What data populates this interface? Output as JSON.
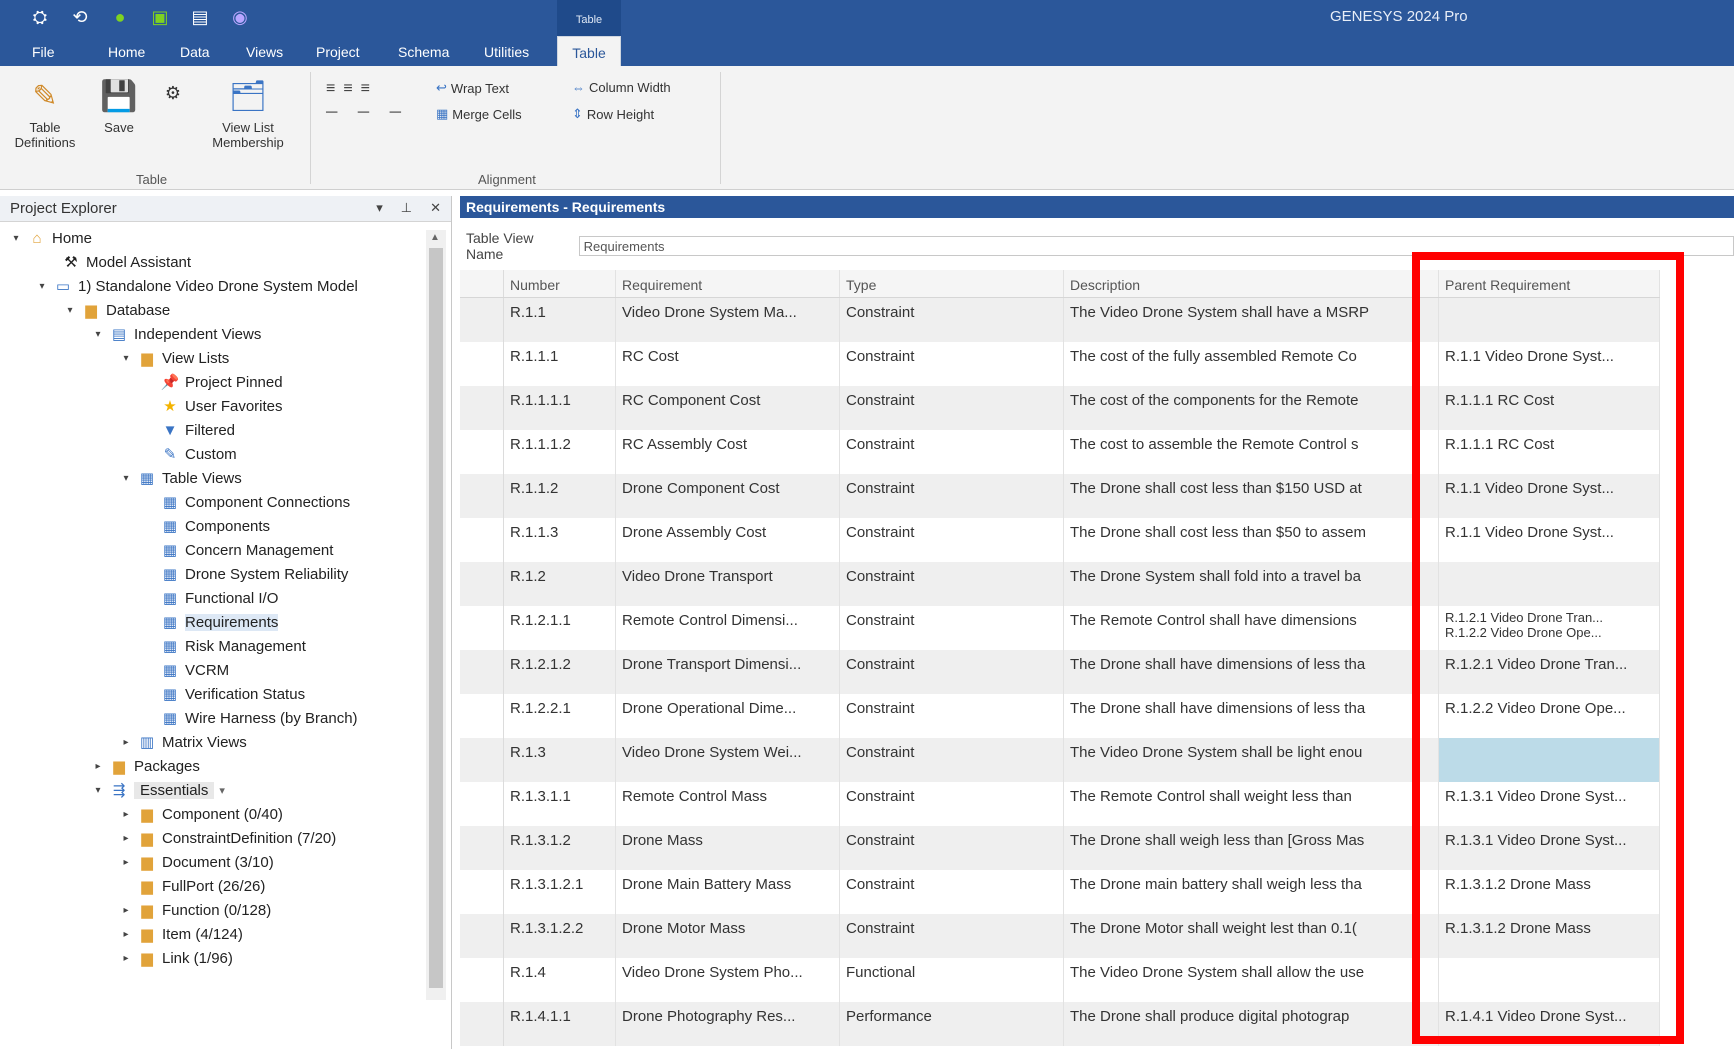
{
  "app": {
    "title": "GENESYS 2024 Pro",
    "context_tab_group": "Table"
  },
  "menu": [
    "File",
    "Home",
    "Data",
    "Views",
    "Project",
    "Schema",
    "Utilities",
    "Table"
  ],
  "ribbon": {
    "table_group": {
      "label": "Table",
      "buttons": [
        "Table Definitions",
        "Save",
        "View List Membership"
      ]
    },
    "alignment_group": {
      "label": "Alignment",
      "wrap_text": "Wrap Text",
      "merge_cells": "Merge Cells",
      "column_width": "Column Width",
      "row_height": "Row Height"
    }
  },
  "explorer": {
    "title": "Project Explorer",
    "nodes": [
      {
        "label": "Home",
        "icon": "home-icon"
      },
      {
        "label": "Model Assistant",
        "icon": "wizard-icon"
      },
      {
        "label": "1) Standalone Video Drone System Model",
        "icon": "project-icon"
      },
      {
        "label": "Database",
        "icon": "folder-icon"
      },
      {
        "label": "Independent Views",
        "icon": "views-icon"
      },
      {
        "label": "View Lists",
        "icon": "folder-icon"
      },
      {
        "label": "Project Pinned",
        "icon": "pin-icon"
      },
      {
        "label": "User Favorites",
        "icon": "star-icon"
      },
      {
        "label": "Filtered",
        "icon": "filter-icon"
      },
      {
        "label": "Custom",
        "icon": "custom-icon"
      },
      {
        "label": "Table Views",
        "icon": "table-icon"
      },
      {
        "label": "Component Connections",
        "icon": "table-icon"
      },
      {
        "label": "Components",
        "icon": "table-icon"
      },
      {
        "label": "Concern Management",
        "icon": "table-icon"
      },
      {
        "label": "Drone System Reliability",
        "icon": "table-icon"
      },
      {
        "label": "Functional I/O",
        "icon": "table-icon"
      },
      {
        "label": "Requirements",
        "icon": "table-icon"
      },
      {
        "label": "Risk Management",
        "icon": "table-icon"
      },
      {
        "label": "VCRM",
        "icon": "table-icon"
      },
      {
        "label": "Verification Status",
        "icon": "table-icon"
      },
      {
        "label": "Wire Harness (by Branch)",
        "icon": "table-icon"
      },
      {
        "label": "Matrix Views",
        "icon": "matrix-icon"
      },
      {
        "label": "Packages",
        "icon": "packages-icon"
      },
      {
        "label": "Essentials",
        "icon": "essentials-icon"
      },
      {
        "label": "Component (0/40)",
        "icon": "folder-icon"
      },
      {
        "label": "ConstraintDefinition (7/20)",
        "icon": "folder-icon"
      },
      {
        "label": "Document (3/10)",
        "icon": "folder-icon"
      },
      {
        "label": "FullPort (26/26)",
        "icon": "folder-icon"
      },
      {
        "label": "Function (0/128)",
        "icon": "folder-icon"
      },
      {
        "label": "Item (4/124)",
        "icon": "folder-icon"
      },
      {
        "label": "Link (1/96)",
        "icon": "folder-icon"
      }
    ]
  },
  "panel": {
    "title": "Requirements - Requirements",
    "view_name_label": "Table View Name",
    "view_name_value": "Requirements"
  },
  "table": {
    "columns": [
      "Number",
      "Requirement",
      "Type",
      "Description",
      "Parent Requirement"
    ],
    "rows": [
      [
        "R.1.1",
        "Video Drone System Ma...",
        "Constraint",
        "The Video Drone System shall have a MSRP",
        ""
      ],
      [
        "R.1.1.1",
        "RC Cost",
        "Constraint",
        "The cost of the fully assembled Remote Co",
        "R.1.1 Video Drone Syst..."
      ],
      [
        "R.1.1.1.1",
        "RC Component Cost",
        "Constraint",
        "The cost of the components for the Remote",
        "R.1.1.1 RC Cost"
      ],
      [
        "R.1.1.1.2",
        "RC Assembly Cost",
        "Constraint",
        "The cost to assemble the Remote Control s",
        "R.1.1.1 RC Cost"
      ],
      [
        "R.1.1.2",
        "Drone Component Cost",
        "Constraint",
        "The Drone shall cost less than $150 USD at",
        "R.1.1 Video Drone Syst..."
      ],
      [
        "R.1.1.3",
        "Drone Assembly Cost",
        "Constraint",
        "The Drone shall cost less than $50 to assem",
        "R.1.1 Video Drone Syst..."
      ],
      [
        "R.1.2",
        "Video Drone Transport",
        "Constraint",
        "The Drone System shall fold into a travel ba",
        ""
      ],
      [
        "R.1.2.1.1",
        "Remote Control Dimensi...",
        "Constraint",
        "The Remote Control shall have dimensions",
        "R.1.2.1 Video Drone Tran...\nR.1.2.2 Video Drone Ope..."
      ],
      [
        "R.1.2.1.2",
        "Drone Transport Dimensi...",
        "Constraint",
        "The Drone shall have dimensions of less tha",
        "R.1.2.1 Video Drone Tran..."
      ],
      [
        "R.1.2.2.1",
        "Drone Operational Dime...",
        "Constraint",
        "The Drone shall have dimensions of less tha",
        "R.1.2.2 Video Drone Ope..."
      ],
      [
        "R.1.3",
        "Video Drone System Wei...",
        "Constraint",
        "The Video Drone System shall be light enou",
        ""
      ],
      [
        "R.1.3.1.1",
        "Remote Control Mass",
        "Constraint",
        "The Remote Control shall weight less than",
        "R.1.3.1 Video Drone Syst..."
      ],
      [
        "R.1.3.1.2",
        "Drone Mass",
        "Constraint",
        "The Drone shall weigh less than [Gross Mas",
        "R.1.3.1 Video Drone Syst..."
      ],
      [
        "R.1.3.1.2.1",
        "Drone Main Battery Mass",
        "Constraint",
        "The Drone main battery shall weigh less tha",
        "R.1.3.1.2 Drone Mass"
      ],
      [
        "R.1.3.1.2.2",
        "Drone Motor Mass",
        "Constraint",
        "The Drone Motor shall weight lest than 0.1(",
        "R.1.3.1.2 Drone Mass"
      ],
      [
        "R.1.4",
        "Video Drone System Pho...",
        "Functional",
        "The Video Drone System shall allow the use",
        ""
      ],
      [
        "R.1.4.1.1",
        "Drone Photography Res...",
        "Performance",
        "The Drone shall produce digital photograp",
        "R.1.4.1 Video Drone Syst..."
      ]
    ]
  }
}
